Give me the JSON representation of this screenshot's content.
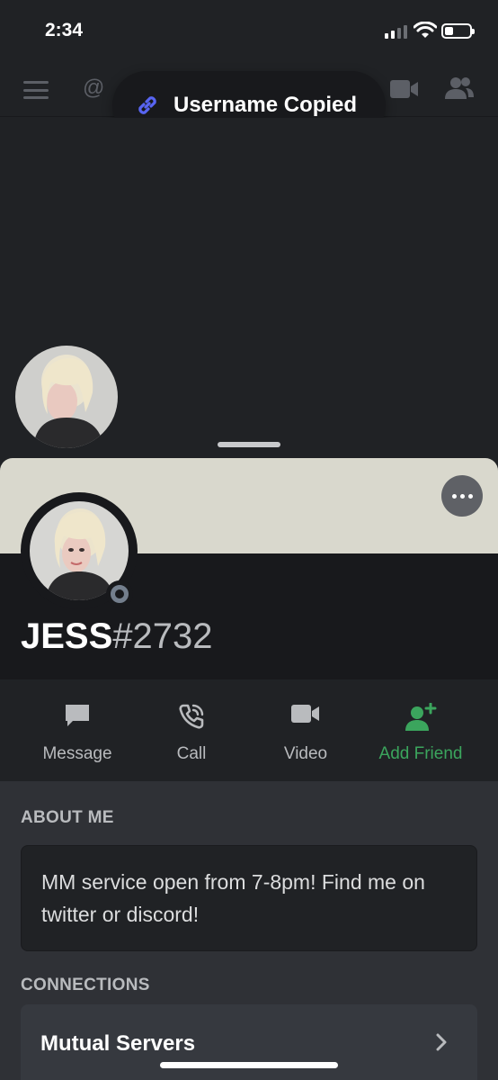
{
  "status_bar": {
    "time": "2:34",
    "battery_level": 0.35
  },
  "toast": {
    "text": "Username Copied",
    "icon": "link-icon",
    "accent": "#5865f2"
  },
  "top_nav": {
    "icons": [
      "hamburger-icon",
      "at-icon",
      "video-icon",
      "people-icon"
    ]
  },
  "profile": {
    "name": "JESS",
    "tag": "#2732",
    "banner_color": "#d9d8cd",
    "status": "offline"
  },
  "actions": [
    {
      "label": "Message",
      "icon": "message-icon"
    },
    {
      "label": "Call",
      "icon": "phone-icon"
    },
    {
      "label": "Video",
      "icon": "video-icon"
    },
    {
      "label": "Add Friend",
      "icon": "add-friend-icon",
      "color": "#3ba55d"
    }
  ],
  "about": {
    "title": "ABOUT ME",
    "text": "MM service open from 7-8pm! Find me on twitter or discord!"
  },
  "connections": {
    "title": "CONNECTIONS",
    "mutual_servers_label": "Mutual Servers"
  }
}
